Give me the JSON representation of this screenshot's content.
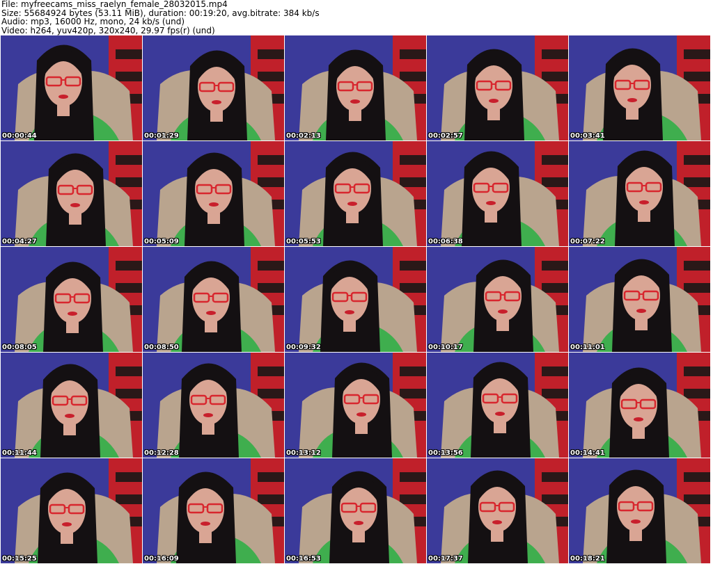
{
  "header": {
    "line1": "File: myfreecams_miss_raelyn_female_28032015.mp4",
    "line2": "Size: 55684924 bytes (53.11 MiB), duration: 00:19:20, avg.bitrate: 384 kb/s",
    "line3": "Audio: mp3, 16000 Hz, mono, 24 kb/s (und)",
    "line4": "Video: h264, yuv420p, 320x240, 29.97 fps(r) (und)"
  },
  "timestamps": [
    "00:00:44",
    "00:01:29",
    "00:02:13",
    "00:02:57",
    "00:03:41",
    "00:04:27",
    "00:05:09",
    "00:05:53",
    "00:06:38",
    "00:07:22",
    "00:08:05",
    "00:08:50",
    "00:09:32",
    "00:10:17",
    "00:11:01",
    "00:11:44",
    "00:12:28",
    "00:13:12",
    "00:13:56",
    "00:14:41",
    "00:15:25",
    "00:16:09",
    "00:16:53",
    "00:17:37",
    "00:18:21"
  ],
  "colors": {
    "wall": "#3b3a9a",
    "shelf": "#c0202a",
    "hair": "#141012",
    "skin": "#d9a594",
    "shirt": "#3fae4e",
    "jacket": "#b9a48e",
    "glasses": "#d8262e"
  }
}
